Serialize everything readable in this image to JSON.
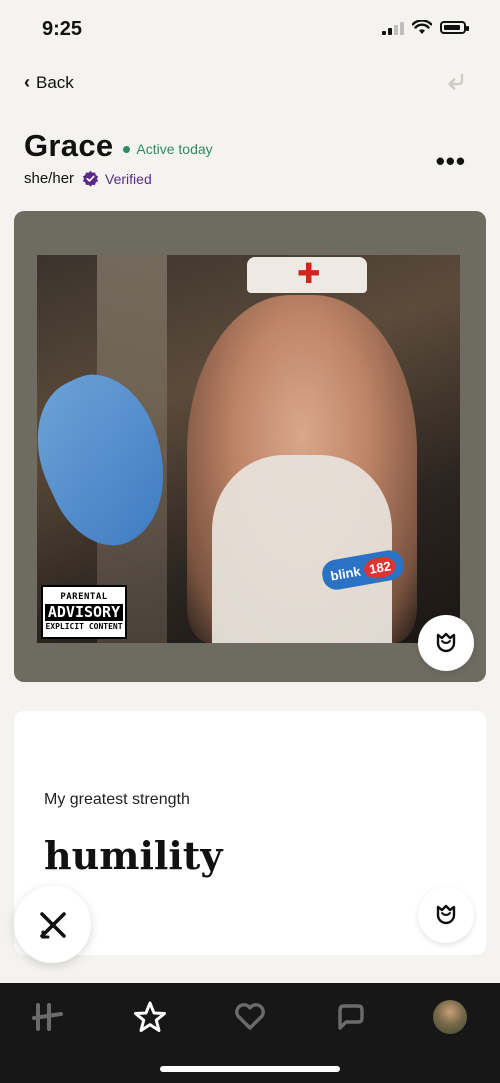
{
  "status_bar": {
    "time": "9:25"
  },
  "nav": {
    "back_label": "Back"
  },
  "profile": {
    "name": "Grace",
    "active_status": "Active today",
    "pronouns": "she/her",
    "verified_label": "Verified"
  },
  "photo": {
    "advisory_line1": "PARENTAL",
    "advisory_line2": "ADVISORY",
    "advisory_line3": "EXPLICIT CONTENT",
    "badge_text": "blink",
    "badge_number": "182"
  },
  "prompt": {
    "question": "My greatest strength",
    "answer": "humility"
  },
  "tab_bar": {
    "items": [
      {
        "icon": "hinge-logo-icon"
      },
      {
        "icon": "star-icon"
      },
      {
        "icon": "heart-chat-icon"
      },
      {
        "icon": "chat-icon"
      },
      {
        "icon": "profile-avatar"
      }
    ]
  },
  "colors": {
    "active_green": "#2e8b5f",
    "verified_purple": "#5b2a86",
    "tab_bar_bg": "#171717"
  }
}
